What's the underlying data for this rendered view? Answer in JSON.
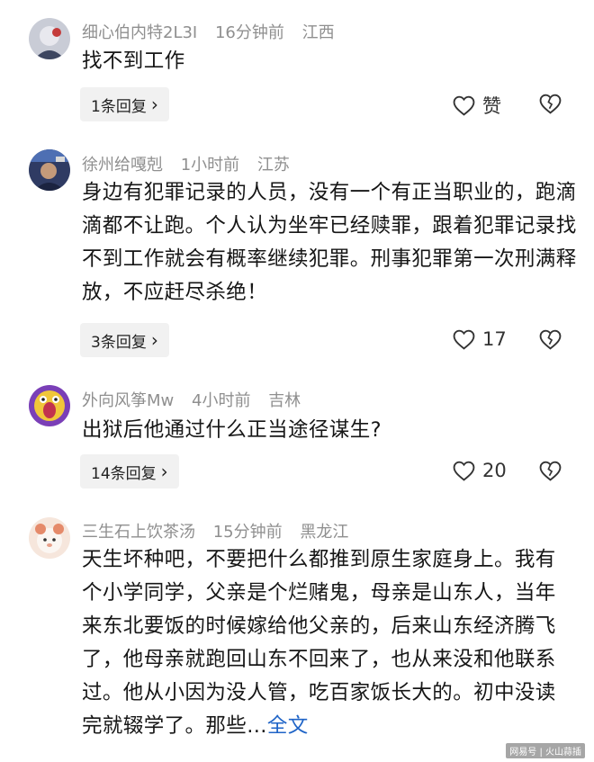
{
  "comments": [
    {
      "user": "细心伯内特2L3I",
      "time": "16分钟前",
      "location": "江西",
      "text": "找不到工作",
      "replies": "1条回复",
      "like_label": "赞"
    },
    {
      "user": "徐州给嘎剋",
      "time": "1小时前",
      "location": "江苏",
      "text": "身边有犯罪记录的人员，没有一个有正当职业的，跑滴滴都不让跑。个人认为坐牢已经赎罪，跟着犯罪记录找不到工作就会有概率继续犯罪。刑事犯罪第一次刑满释放，不应赶尽杀绝！",
      "replies": "3条回复",
      "like_label": "17"
    },
    {
      "user": "外向风筝Mw",
      "time": "4小时前",
      "location": "吉林",
      "text": "出狱后他通过什么正当途径谋生?",
      "replies": "14条回复",
      "like_label": "20"
    },
    {
      "user": "三生石上饮茶汤",
      "time": "15分钟前",
      "location": "黑龙江",
      "text": "天生坏种吧，不要把什么都推到原生家庭身上。我有个小学同学，父亲是个烂赌鬼，母亲是山东人，当年来东北要饭的时候嫁给他父亲的，后来山东经济腾飞了，他母亲就跑回山东不回来了，也从来没和他联系过。他从小因为没人管，吃百家饭长大的。初中没读完就辍学了。那些...",
      "expand_link": "全文"
    }
  ],
  "watermark": "网易号 | 火山蒜插",
  "colors": {
    "meta_text": "#8f8f8f",
    "body_text": "#161616",
    "reply_bg": "#f1f1f1",
    "link": "#1f64c7"
  },
  "icons": [
    "heart-outline-icon",
    "broken-heart-icon",
    "chevron-right-icon"
  ]
}
